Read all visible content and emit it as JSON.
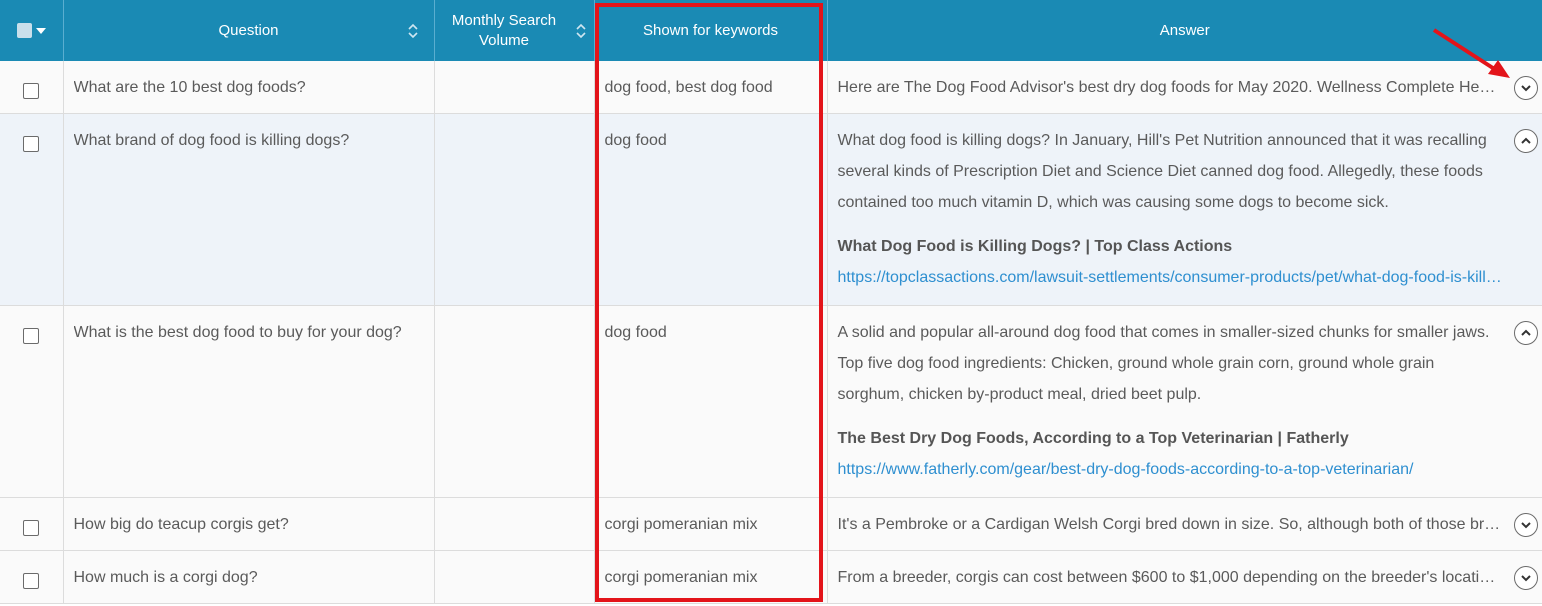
{
  "headers": {
    "question": "Question",
    "volume": "Monthly Search Volume",
    "keywords": "Shown for keywords",
    "answer": "Answer"
  },
  "rows": [
    {
      "question": "What are the 10 best dog foods?",
      "volume": "",
      "keywords": "dog food, best dog food",
      "answer": "Here are The Dog Food Advisor's best dry dog foods for May 2020. Wellness Complete Health...",
      "expanded": false
    },
    {
      "question": "What brand of dog food is killing dogs?",
      "volume": "",
      "keywords": "dog food",
      "answer": "What dog food is killing dogs? In January, Hill's Pet Nutrition announced that it was recalling several kinds of Prescription Diet and Science Diet canned dog food. Allegedly, these foods contained too much vitamin D, which was causing some dogs to become sick.",
      "source_title": "What Dog Food is Killing Dogs? | Top Class Actions",
      "source_url": "https://topclassactions.com/lawsuit-settlements/consumer-products/pet/what-dog-food-is-killing-dogs/",
      "expanded": true
    },
    {
      "question": "What is the best dog food to buy for your dog?",
      "volume": "",
      "keywords": "dog food",
      "answer": "A solid and popular all-around dog food that comes in smaller-sized chunks for smaller jaws. Top five dog food ingredients: Chicken, ground whole grain corn, ground whole grain sorghum, chicken by-product meal, dried beet pulp.",
      "source_title": "The Best Dry Dog Foods, According to a Top Veterinarian | Fatherly",
      "source_url": "https://www.fatherly.com/gear/best-dry-dog-foods-according-to-a-top-veterinarian/",
      "expanded": true
    },
    {
      "question": "How big do teacup corgis get?",
      "volume": "",
      "keywords": "corgi pomeranian mix",
      "answer": "It's a Pembroke or a Cardigan Welsh Corgi bred down in size. So, although both of those breeds...",
      "expanded": false
    },
    {
      "question": "How much is a corgi dog?",
      "volume": "",
      "keywords": "corgi pomeranian mix",
      "answer": "From a breeder, corgis can cost between $600 to $1,000 depending on the breeder's location...",
      "expanded": false
    }
  ],
  "colors": {
    "header_bg": "#1a8ab4",
    "highlight": "#e3141a",
    "link": "#2e8fd0"
  },
  "icons": {
    "sort": "sort-updown-icon",
    "expand": "chevron-down-icon",
    "collapse": "chevron-up-icon"
  }
}
